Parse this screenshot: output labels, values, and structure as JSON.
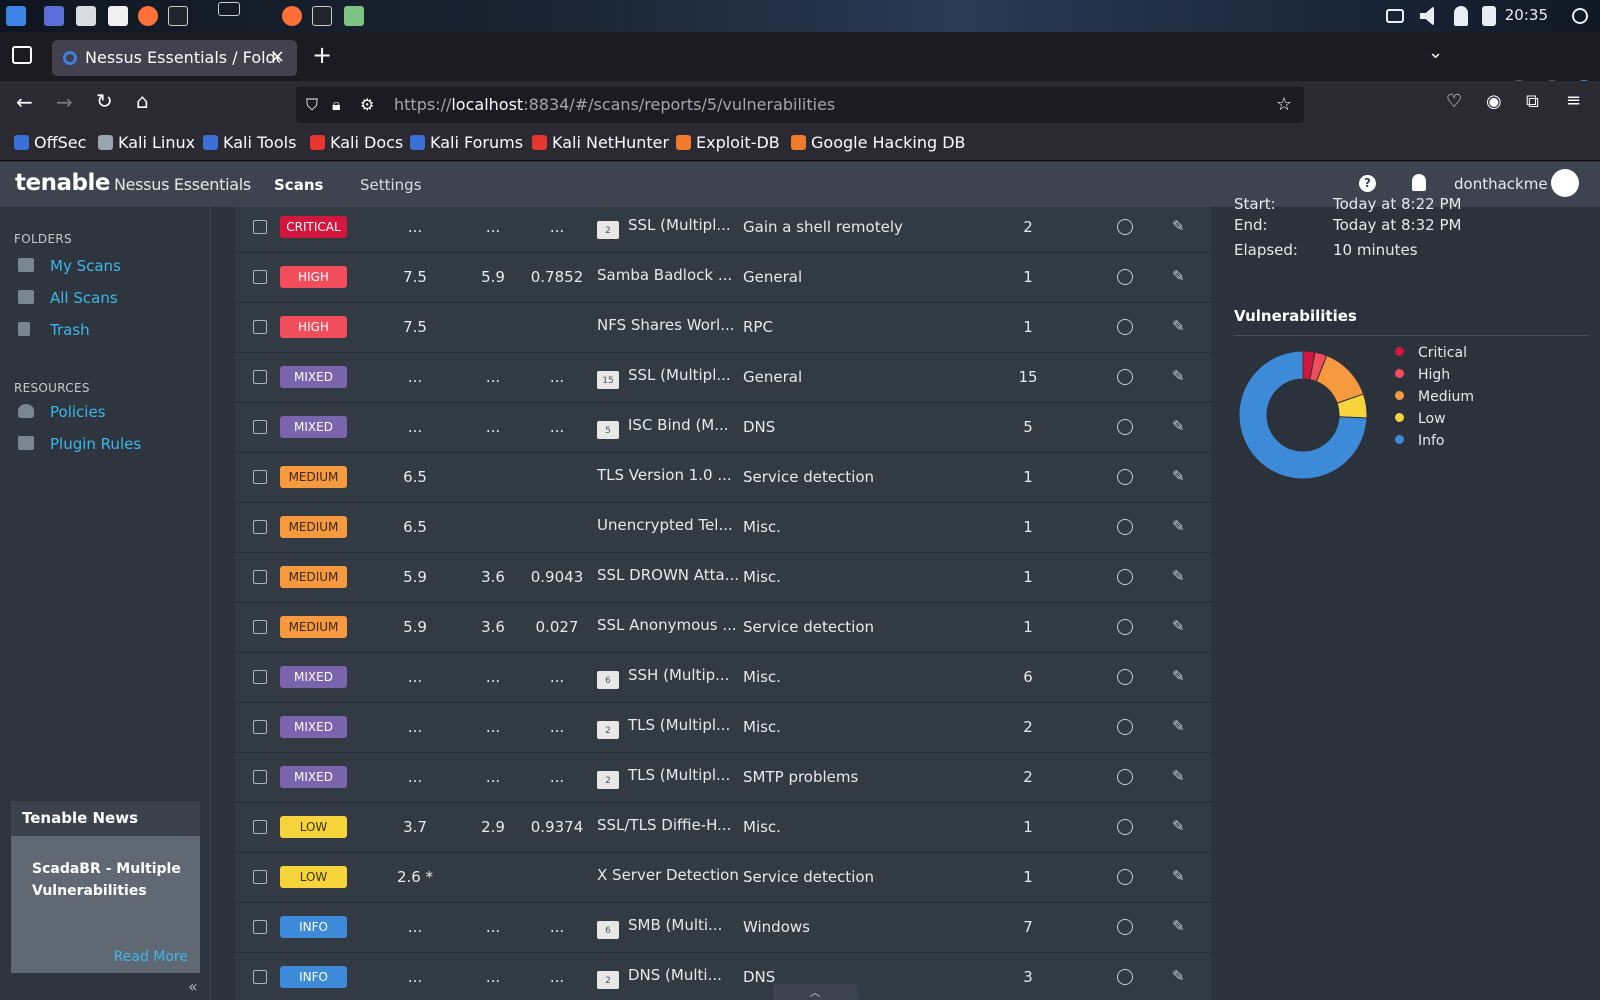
{
  "os": {
    "clock": "20:35"
  },
  "browser": {
    "tab_title": "Nessus Essentials / Folder",
    "url_prefix": "https://",
    "url_host": "localhost",
    "url_rest": ":8834/#/scans/reports/5/vulnerabilities",
    "bookmarks": [
      "OffSec",
      "Kali Linux",
      "Kali Tools",
      "Kali Docs",
      "Kali Forums",
      "Kali NetHunter",
      "Exploit-DB",
      "Google Hacking DB"
    ]
  },
  "header": {
    "brand": "tenable",
    "product": "Nessus Essentials",
    "nav_scans": "Scans",
    "nav_settings": "Settings",
    "username": "donthackme"
  },
  "sidebar": {
    "folders_heading": "FOLDERS",
    "folders": [
      "My Scans",
      "All Scans",
      "Trash"
    ],
    "resources_heading": "RESOURCES",
    "resources": [
      "Policies",
      "Plugin Rules"
    ],
    "news_title": "Tenable News",
    "news_headline": "ScadaBR - Multiple Vulnerabilities",
    "news_link": "Read More"
  },
  "rows": [
    {
      "sev": "CRITICAL",
      "cvss": "...",
      "vpr": "...",
      "epss": "...",
      "group": "2",
      "name": "SSL (Multipl...",
      "family": "Gain a shell remotely",
      "count": "2"
    },
    {
      "sev": "HIGH",
      "cvss": "7.5",
      "vpr": "5.9",
      "epss": "0.7852",
      "group": "",
      "name": "Samba Badlock ...",
      "family": "General",
      "count": "1"
    },
    {
      "sev": "HIGH",
      "cvss": "7.5",
      "vpr": "",
      "epss": "",
      "group": "",
      "name": "NFS Shares Worl...",
      "family": "RPC",
      "count": "1"
    },
    {
      "sev": "MIXED",
      "cvss": "...",
      "vpr": "...",
      "epss": "...",
      "group": "15",
      "name": "SSL (Multipl...",
      "family": "General",
      "count": "15"
    },
    {
      "sev": "MIXED",
      "cvss": "...",
      "vpr": "...",
      "epss": "...",
      "group": "5",
      "name": "ISC Bind (M...",
      "family": "DNS",
      "count": "5"
    },
    {
      "sev": "MEDIUM",
      "cvss": "6.5",
      "vpr": "",
      "epss": "",
      "group": "",
      "name": "TLS Version 1.0 ...",
      "family": "Service detection",
      "count": "1"
    },
    {
      "sev": "MEDIUM",
      "cvss": "6.5",
      "vpr": "",
      "epss": "",
      "group": "",
      "name": "Unencrypted Tel...",
      "family": "Misc.",
      "count": "1"
    },
    {
      "sev": "MEDIUM",
      "cvss": "5.9",
      "vpr": "3.6",
      "epss": "0.9043",
      "group": "",
      "name": "SSL DROWN Atta...",
      "family": "Misc.",
      "count": "1"
    },
    {
      "sev": "MEDIUM",
      "cvss": "5.9",
      "vpr": "3.6",
      "epss": "0.027",
      "group": "",
      "name": "SSL Anonymous ...",
      "family": "Service detection",
      "count": "1"
    },
    {
      "sev": "MIXED",
      "cvss": "...",
      "vpr": "...",
      "epss": "...",
      "group": "6",
      "name": "SSH (Multip...",
      "family": "Misc.",
      "count": "6"
    },
    {
      "sev": "MIXED",
      "cvss": "...",
      "vpr": "...",
      "epss": "...",
      "group": "2",
      "name": "TLS (Multipl...",
      "family": "Misc.",
      "count": "2"
    },
    {
      "sev": "MIXED",
      "cvss": "...",
      "vpr": "...",
      "epss": "...",
      "group": "2",
      "name": "TLS (Multipl...",
      "family": "SMTP problems",
      "count": "2"
    },
    {
      "sev": "LOW",
      "cvss": "3.7",
      "vpr": "2.9",
      "epss": "0.9374",
      "group": "",
      "name": "SSL/TLS Diffie-H...",
      "family": "Misc.",
      "count": "1"
    },
    {
      "sev": "LOW",
      "cvss": "2.6 *",
      "vpr": "",
      "epss": "",
      "group": "",
      "name": "X Server Detection",
      "family": "Service detection",
      "count": "1"
    },
    {
      "sev": "INFO",
      "cvss": "...",
      "vpr": "...",
      "epss": "...",
      "group": "6",
      "name": "SMB (Multi...",
      "family": "Windows",
      "count": "7"
    },
    {
      "sev": "INFO",
      "cvss": "...",
      "vpr": "...",
      "epss": "...",
      "group": "2",
      "name": "DNS (Multi...",
      "family": "DNS",
      "count": "3"
    }
  ],
  "details": {
    "start_label": "Start:",
    "start_value": "Today at 8:22 PM",
    "end_label": "End:",
    "end_value": "Today at 8:32 PM",
    "elapsed_label": "Elapsed:",
    "elapsed_value": "10 minutes",
    "vuln_title": "Vulnerabilities"
  },
  "chart_data": {
    "type": "pie",
    "categories": [
      "Critical",
      "High",
      "Medium",
      "Low",
      "Info"
    ],
    "values": [
      2,
      2,
      9,
      4,
      49
    ],
    "colors": [
      "#d3163d",
      "#f14d5c",
      "#f79a3f",
      "#f7d43b",
      "#3d8ad8"
    ]
  },
  "colors": {
    "accent": "#3bb7e8",
    "header_bg": "#3d4450",
    "table_bg": "#323a44"
  }
}
